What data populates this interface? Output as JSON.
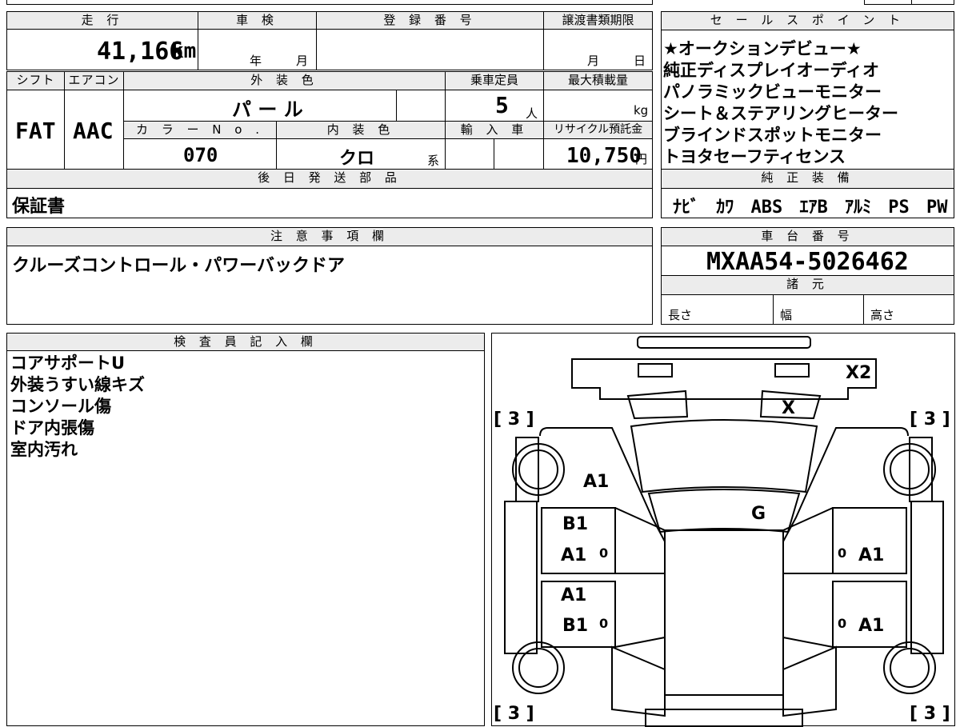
{
  "top_block": {
    "headers": {
      "mileage": "走 行",
      "inspection": "車 検",
      "registration": "登 録 番 号",
      "transfer_deadline": "譲渡書類期限",
      "shift": "シフト",
      "aircon": "エアコン",
      "exterior_color": "外 装 色",
      "capacity": "乗車定員",
      "max_load": "最大積載量",
      "color_no": "カ ラ ー N o .",
      "interior_color": "内 装 色",
      "import": "輸 入 車",
      "recycle": "リサイクル預託金",
      "later_parts": "後 日 発 送 部 品"
    },
    "mileage_value": "41,166",
    "mileage_unit": "km",
    "inspection_year": "年",
    "inspection_month": "月",
    "transfer_month": "月",
    "transfer_day": "日",
    "shift_value": "FAT",
    "aircon_value": "AAC",
    "exterior_color_value": "パ ー ル",
    "capacity_value": "5",
    "capacity_unit": "人",
    "max_load_unit": "kg",
    "color_no_value": "070",
    "interior_color_value": "クロ",
    "interior_color_suffix": "系",
    "recycle_value": "10,750",
    "recycle_unit": "円",
    "later_parts_value": "保証書"
  },
  "sales": {
    "header": "セ ー ル ス ポ イ ン ト",
    "points": [
      "★オークションデビュー★",
      "純正ディスプレイオーディオ",
      "パノラミックビューモニター",
      "シート＆ステアリングヒーター",
      "ブラインドスポットモニター",
      "トヨタセーフティセンス"
    ],
    "equipment_header": "純 正 装 備",
    "equipment": [
      "ﾅﾋﾞ",
      "ｶﾜ",
      "ABS",
      "ｴｱB",
      "ｱﾙﾐ",
      "PS",
      "PW"
    ]
  },
  "notes": {
    "header": "注 意 事 項 欄",
    "text": "クルーズコントロール・パワーバックドア"
  },
  "chassis": {
    "header": "車 台 番 号",
    "number": "MXAA54-5026462",
    "spec_header": "諸 元",
    "length_label": "長さ",
    "width_label": "幅",
    "height_label": "高さ"
  },
  "inspector": {
    "header": "検 査 員 記 入 欄",
    "lines": [
      "コアサポートU",
      "外装うすい線キズ",
      "コンソール傷",
      "ドア内張傷",
      "室内汚れ"
    ]
  },
  "diagram": {
    "tire_fl": "[ 3 ]",
    "tire_fr": "[ 3 ]",
    "tire_rl": "[ 3 ]",
    "tire_rr": "[ 3 ]",
    "front_mark": "X2",
    "windshield_mark": "X",
    "fender_mark": "A1",
    "roof_mark": "G",
    "door_fl_mark1": "B1",
    "door_fl_mark2": "A1",
    "door_rl_mark1": "A1",
    "door_rl_mark2": "B1",
    "door_fr_mark": "A1",
    "door_rr_mark": "A1",
    "small_zero": "0"
  }
}
